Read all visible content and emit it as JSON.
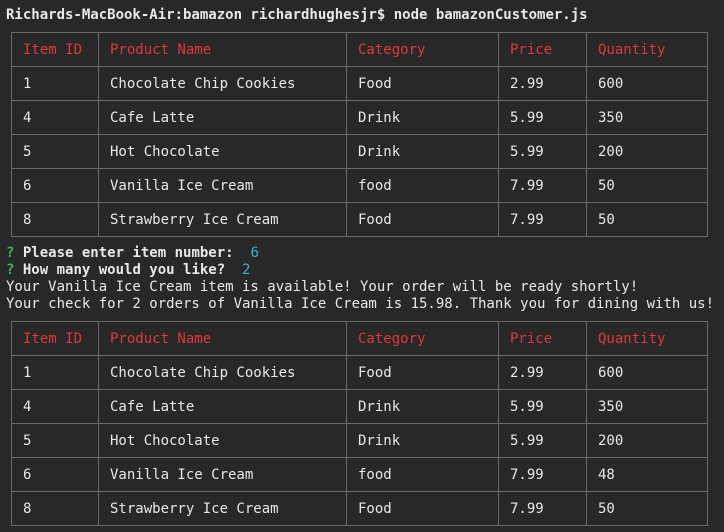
{
  "terminal": {
    "prompt": "Richards-MacBook-Air:bamazon richardhughesjr$ node bamazonCustomer.js",
    "question_mark": "?",
    "q1_label": "Please enter item number:",
    "q1_answer": "6",
    "q2_label": "How many would you like?",
    "q2_answer": "2",
    "message1": "Your Vanilla Ice Cream item is available! Your order will be ready shortly!",
    "message2": "Your check for 2 orders of Vanilla Ice Cream is 15.98. Thank you for dining with us!"
  },
  "colors": {
    "header_text": "#e0383a",
    "question_mark": "#3fb34f",
    "answer": "#2fb6d2",
    "background": "#282828"
  },
  "columns": [
    "Item ID",
    "Product Name",
    "Category",
    "Price",
    "Quantity"
  ],
  "table1": {
    "rows": [
      [
        "1",
        "Chocolate Chip Cookies",
        "Food",
        "2.99",
        "600"
      ],
      [
        "4",
        "Cafe Latte",
        "Drink",
        "5.99",
        "350"
      ],
      [
        "5",
        "Hot Chocolate",
        "Drink",
        "5.99",
        "200"
      ],
      [
        "6",
        "Vanilla Ice Cream",
        "food",
        "7.99",
        "50"
      ],
      [
        "8",
        "Strawberry Ice Cream",
        "Food",
        "7.99",
        "50"
      ]
    ]
  },
  "table2": {
    "rows": [
      [
        "1",
        "Chocolate Chip Cookies",
        "Food",
        "2.99",
        "600"
      ],
      [
        "4",
        "Cafe Latte",
        "Drink",
        "5.99",
        "350"
      ],
      [
        "5",
        "Hot Chocolate",
        "Drink",
        "5.99",
        "200"
      ],
      [
        "6",
        "Vanilla Ice Cream",
        "food",
        "7.99",
        "48"
      ],
      [
        "8",
        "Strawberry Ice Cream",
        "Food",
        "7.99",
        "50"
      ]
    ]
  }
}
